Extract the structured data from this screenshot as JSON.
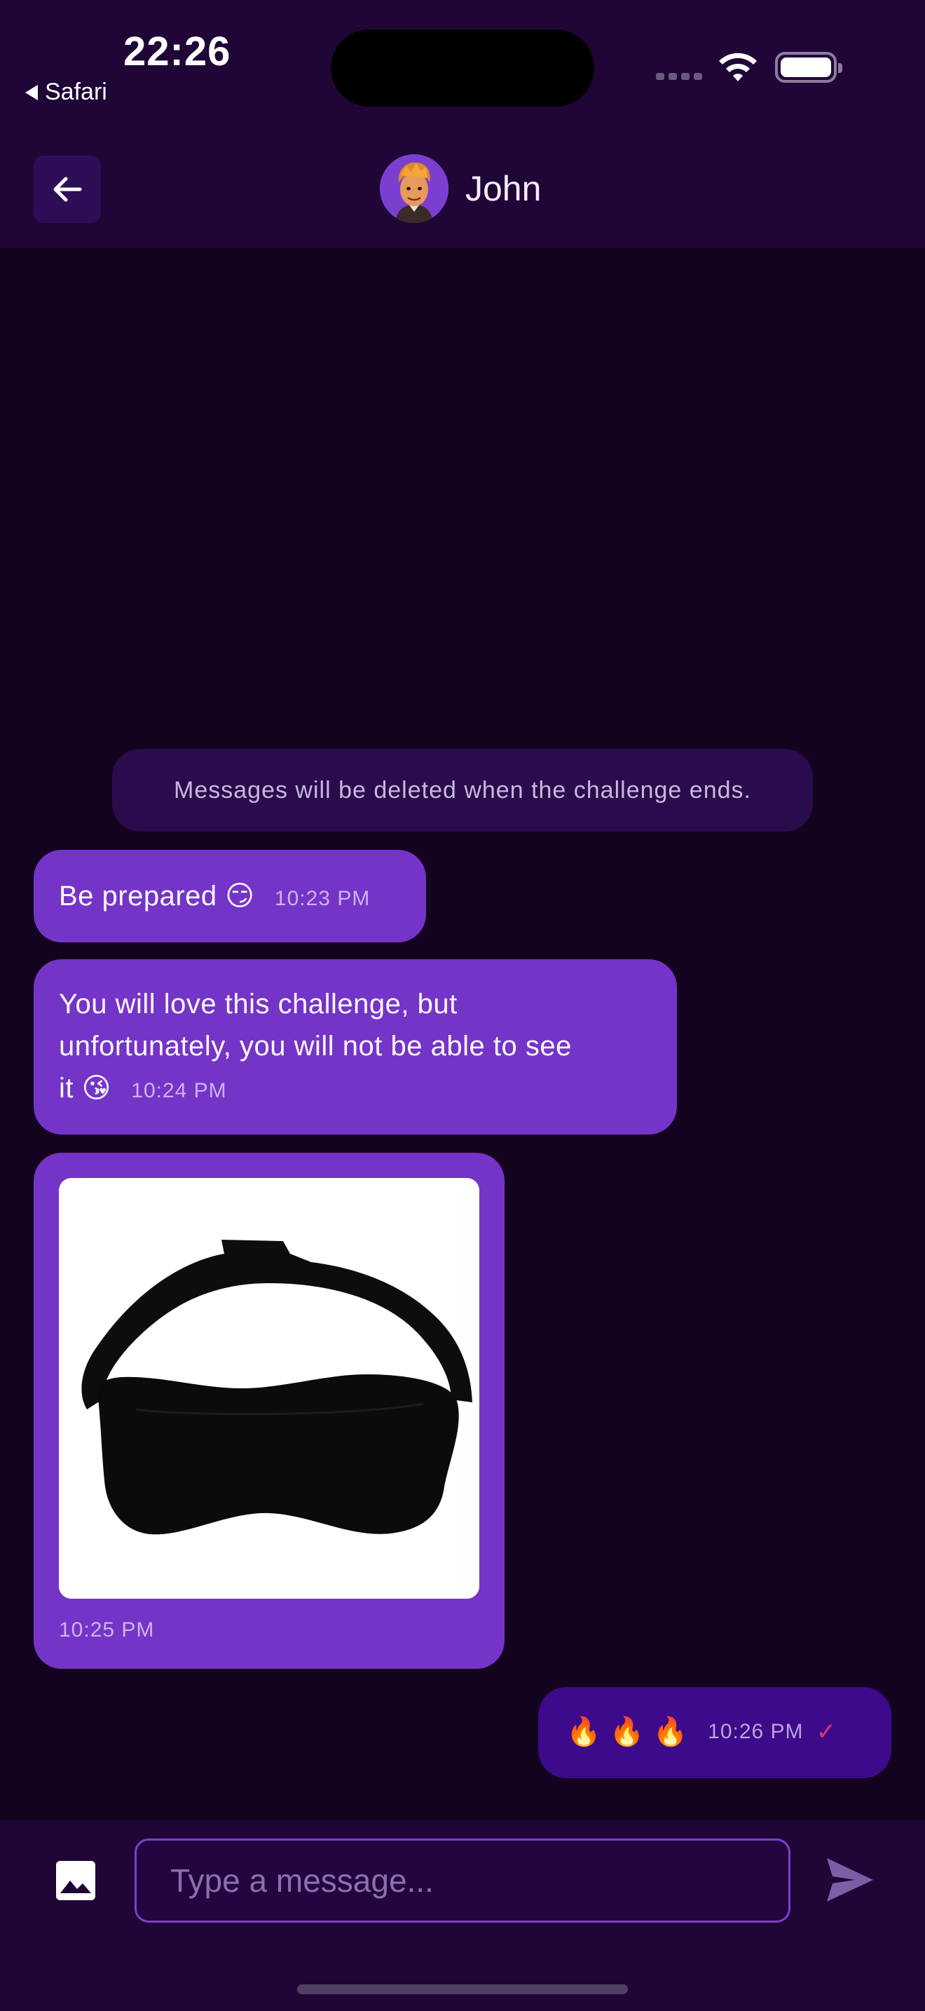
{
  "status_bar": {
    "time": "22:26",
    "back_app": "Safari"
  },
  "header": {
    "contact_name": "John",
    "back_icon": "arrow-left-icon",
    "avatar_icon": "avatar"
  },
  "chat": {
    "notice": "Messages will be deleted when the challenge ends.",
    "messages": [
      {
        "text": "Be prepared 😏",
        "time": "10:23 PM",
        "sender": "contact"
      },
      {
        "text_line1": "You will love this challenge, but",
        "text_line2": "unfortunately, you will not be able to see",
        "text_line3": "it 😘",
        "time": "10:24 PM",
        "sender": "contact"
      },
      {
        "image": "sleep-mask-photo",
        "time": "10:25 PM",
        "sender": "contact"
      },
      {
        "text": "🔥 🔥 🔥",
        "time": "10:26 PM",
        "status": "✓",
        "sender": "me"
      }
    ]
  },
  "composer": {
    "placeholder": "Type a message...",
    "image_icon": "image-icon",
    "send_icon": "send-icon"
  },
  "colors": {
    "background": "#14031f",
    "bars": "#1f0637",
    "bubble_incoming": "#7534c8",
    "bubble_outgoing": "#3c0a8a",
    "accent": "#7b3fd0",
    "read_check": "#e0356f"
  }
}
